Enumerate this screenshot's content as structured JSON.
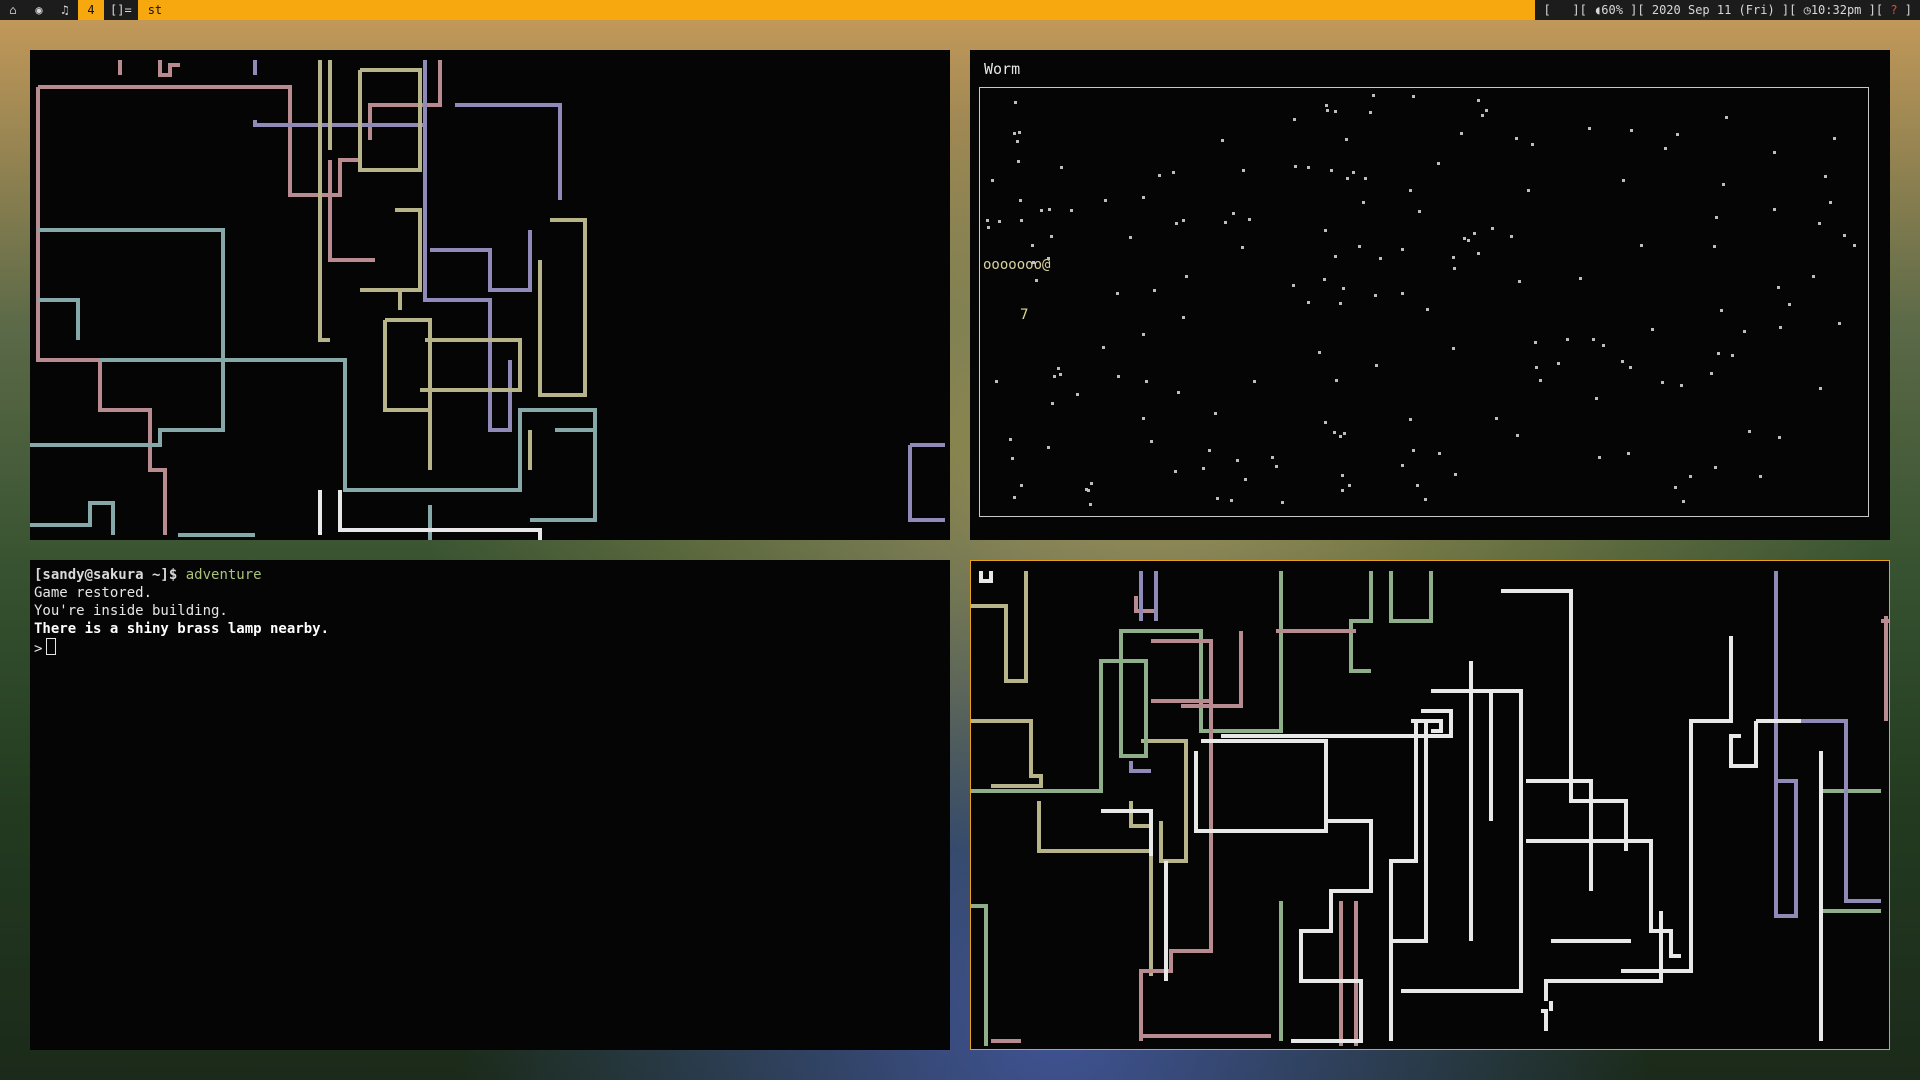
{
  "topbar": {
    "tags": [
      {
        "icon": "home-icon",
        "glyph": "⌂"
      },
      {
        "icon": "firefox-icon",
        "glyph": "◉"
      },
      {
        "icon": "music-icon",
        "glyph": "♫"
      },
      {
        "label": "4"
      }
    ],
    "layout": "[]=",
    "window_title": "st",
    "status": {
      "volume": "60%",
      "date": "2020 Sep 11 (Fri)",
      "time": "10:32pm",
      "help": "?"
    },
    "colors": {
      "bar": "#f7a80f",
      "dark": "#1c1c1c"
    }
  },
  "worm": {
    "title": "Worm",
    "body": "ooooooo@",
    "food": "7"
  },
  "terminal": {
    "prompt": "[sandy@sakura ~]$",
    "command": "adventure",
    "lines": [
      "Game restored.",
      "You're inside building."
    ],
    "bold_line": "There is a shiny brass lamp nearby.",
    "input_prompt": ">"
  },
  "pipes_colors": {
    "pink": "#b78b8f",
    "purple": "#8f8ab8",
    "teal": "#86a8a8",
    "olive": "#b8b48a",
    "white": "#e8e8e8",
    "green": "#8fae8a"
  }
}
